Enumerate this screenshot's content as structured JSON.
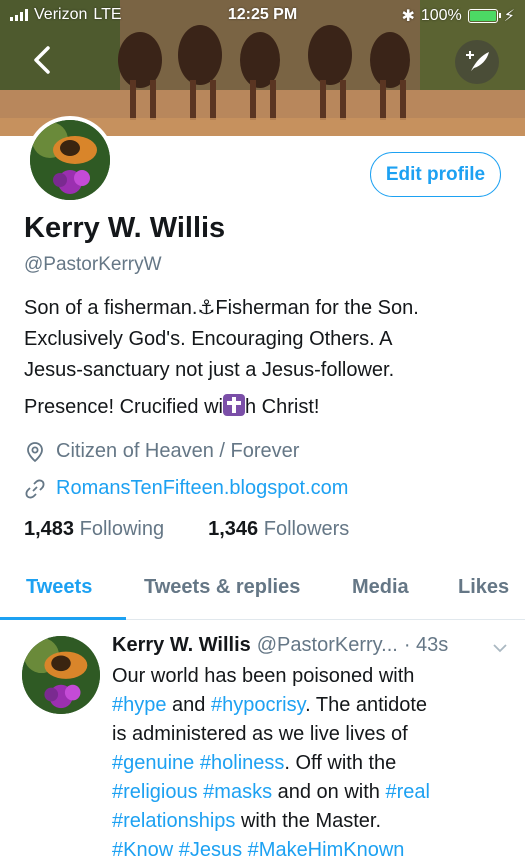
{
  "status_bar": {
    "carrier": "Verizon",
    "network": "LTE",
    "time": "12:25 PM",
    "battery": "100%",
    "battery_level": 1.0
  },
  "profile": {
    "edit_label": "Edit profile",
    "name": "Kerry W. Willis",
    "handle": "@PastorKerryW",
    "bio_lines": [
      "Son of a fisherman.⚓Fisherman for the Son.",
      "Exclusively God's. Encouraging Others. A",
      "Jesus-sanctuary not just a Jesus-follower."
    ],
    "bio_last_before": "Presence! Crucified wi",
    "bio_last_after": "h Christ!",
    "location": "Citizen of Heaven / Forever",
    "website": "RomansTenFifteen.blogspot.com",
    "following_count": "1,483",
    "following_label": "Following",
    "followers_count": "1,346",
    "followers_label": "Followers"
  },
  "tabs": [
    "Tweets",
    "Tweets & replies",
    "Media",
    "Likes"
  ],
  "active_tab": "Tweets",
  "tweet": {
    "name": "Kerry W. Willis",
    "handle": "@PastorKerry...",
    "time": "· 43s",
    "line1": "Our world has been poisoned with",
    "line2_tag1": "#hype",
    "line2_mid": " and ",
    "line2_tag2": "#hypocrisy",
    "line2_end": ". The antidote",
    "line3": "is administered as we live lives of",
    "line4_tag1": "#genuine",
    "line4_tag2": "#holiness",
    "line4_end": ". Off with the",
    "line5_tag1": "#religious",
    "line5_tag2": "#masks",
    "line5_mid": " and on with ",
    "line5_tag3": "#real",
    "line6_tag1": "#relationships",
    "line6_end": " with the Master.",
    "line7_tag1": "#Know",
    "line7_tag2": "#Jesus",
    "line7_tag3": "#MakeHimKnown"
  },
  "colors": {
    "accent": "#1da1f2",
    "secondary_text": "#657786",
    "battery_fill": "#4cd964"
  }
}
